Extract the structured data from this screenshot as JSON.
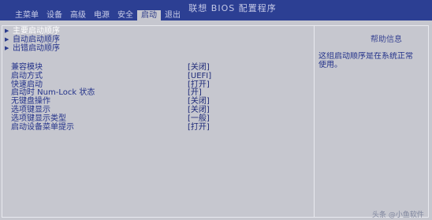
{
  "bios_title": "联想 BIOS 配置程序",
  "menu": [
    {
      "label": "主菜单",
      "active": false
    },
    {
      "label": "设备",
      "active": false
    },
    {
      "label": "高级",
      "active": false
    },
    {
      "label": "电源",
      "active": false
    },
    {
      "label": "安全",
      "active": false
    },
    {
      "label": "启动",
      "active": true
    },
    {
      "label": "退出",
      "active": false
    }
  ],
  "submenus": [
    {
      "label": "主要启动顺序",
      "highlight": true
    },
    {
      "label": "自动启动顺序",
      "highlight": false
    },
    {
      "label": "出错启动顺序",
      "highlight": false
    }
  ],
  "settings": [
    {
      "label": "兼容模块",
      "value": "[关闭]"
    },
    {
      "label": "启动方式",
      "value": "[UEFI]"
    },
    {
      "label": "快速启动",
      "value": "[打开]"
    },
    {
      "label": "启动时 Num-Lock 状态",
      "value": "[开]"
    },
    {
      "label": "无键盘操作",
      "value": "[关闭]"
    },
    {
      "label": "选项键显示",
      "value": "[关闭]"
    },
    {
      "label": "选项键显示类型",
      "value": "[一般]"
    },
    {
      "label": "启动设备菜单提示",
      "value": "[打开]"
    }
  ],
  "help": {
    "title": "帮助信息",
    "lines": [
      "这组启动顺序是在系统正常",
      "使用。"
    ]
  },
  "watermark": "头条 @小鱼软件"
}
